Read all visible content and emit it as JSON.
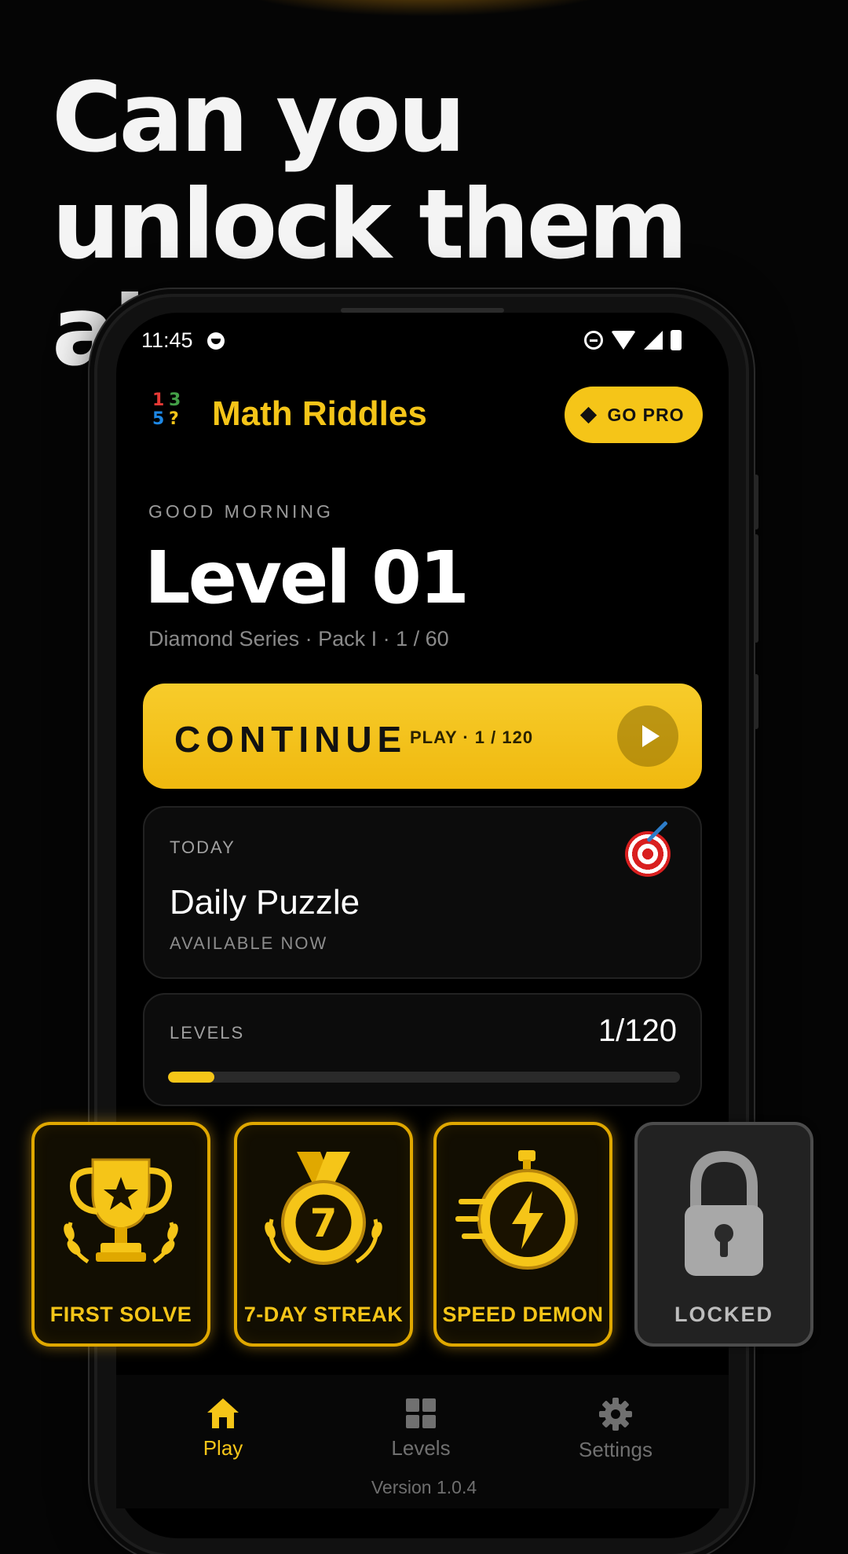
{
  "headline": {
    "line1": "Can you",
    "line2": "unlock them all?"
  },
  "status_bar": {
    "time": "11:45"
  },
  "app": {
    "logo_digits": [
      "1",
      "3",
      "5",
      "?"
    ],
    "logo_colors": [
      "#e53935",
      "#43a047",
      "#1e88e5",
      "#f5c518"
    ],
    "title": "Math Riddles",
    "go_pro_label": "GO PRO"
  },
  "hero": {
    "greeting": "GOOD MORNING",
    "level_title": "Level 01",
    "series": "Diamond Series · Pack I · 1 / 60"
  },
  "continue_button": {
    "label": "CONTINUE",
    "sub": "PLAY · 1 / 120"
  },
  "daily": {
    "tag": "TODAY",
    "title": "Daily Puzzle",
    "subtitle": "AVAILABLE NOW",
    "icon": "target-icon"
  },
  "levels": {
    "tag": "LEVELS",
    "count": "1/120",
    "progress": 0.09
  },
  "badges": [
    {
      "label": "FIRST SOLVE",
      "icon": "trophy-icon",
      "locked": false
    },
    {
      "label": "7-DAY STREAK",
      "icon": "medal-icon",
      "medal_number": "7",
      "locked": false
    },
    {
      "label": "SPEED DEMON",
      "icon": "stopwatch-icon",
      "locked": false
    },
    {
      "label": "LOCKED",
      "icon": "padlock-icon",
      "locked": true
    }
  ],
  "nav": {
    "items": [
      {
        "label": "Play",
        "icon": "home-icon",
        "active": true
      },
      {
        "label": "Levels",
        "icon": "grid-icon",
        "active": false
      },
      {
        "label": "Settings",
        "icon": "gear-icon",
        "active": false
      }
    ]
  },
  "version": "Version 1.0.4",
  "colors": {
    "accent": "#f5c518",
    "background": "#000000"
  }
}
